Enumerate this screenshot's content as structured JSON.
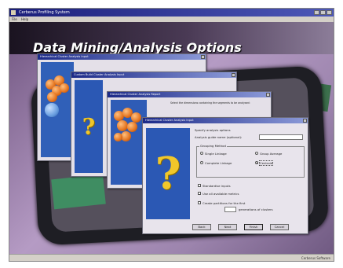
{
  "app": {
    "title": "Cerberus Profiling System",
    "menu": [
      "File",
      "Help"
    ]
  },
  "banner": {
    "title": "Data Mining/Analysis Options"
  },
  "windows": [
    {
      "title": "Hierarchical Cluster Analysis Input"
    },
    {
      "title": "Custom Build Cluster Analysis Input"
    },
    {
      "title": "Hierarchical Cluster Analysis Report",
      "text": "Select the dimensions containing the segments to be analysed:"
    },
    {
      "title": "Hierarchical Cluster Analysis Input"
    }
  ],
  "front_dialog": {
    "heading": "Specify analysis options",
    "analysis_name_label": "Analysis guide name (optional):",
    "analysis_name_value": "",
    "group_title": "Grouping Method",
    "methods": [
      {
        "label": "Single Linkage",
        "selected": false
      },
      {
        "label": "Group Average",
        "selected": false
      },
      {
        "label": "Complete Linkage",
        "selected": false
      },
      {
        "label": "Centroid",
        "selected": true
      }
    ],
    "options": [
      {
        "label": "Standardise inputs"
      },
      {
        "label": "Use all available metrics"
      }
    ],
    "clusters_label": "Create partitions for the first",
    "clusters_value": "",
    "clusters_suffix": "generations of clusters",
    "buttons": {
      "back": "Back",
      "next": "Next",
      "finish": "Finish",
      "cancel": "Cancel"
    }
  },
  "status": {
    "brand": "Cerberus Software"
  },
  "colors": {
    "title_bar": "#1b1f7a",
    "art_blue": "#2b58b4",
    "question_mark": "#f1c72a",
    "sphere_orange": "#e3731e",
    "board_dark": "#1e1e24"
  },
  "icons": [
    "question-mark-icon",
    "sphere-cluster-icon",
    "close-icon",
    "app-icon"
  ]
}
